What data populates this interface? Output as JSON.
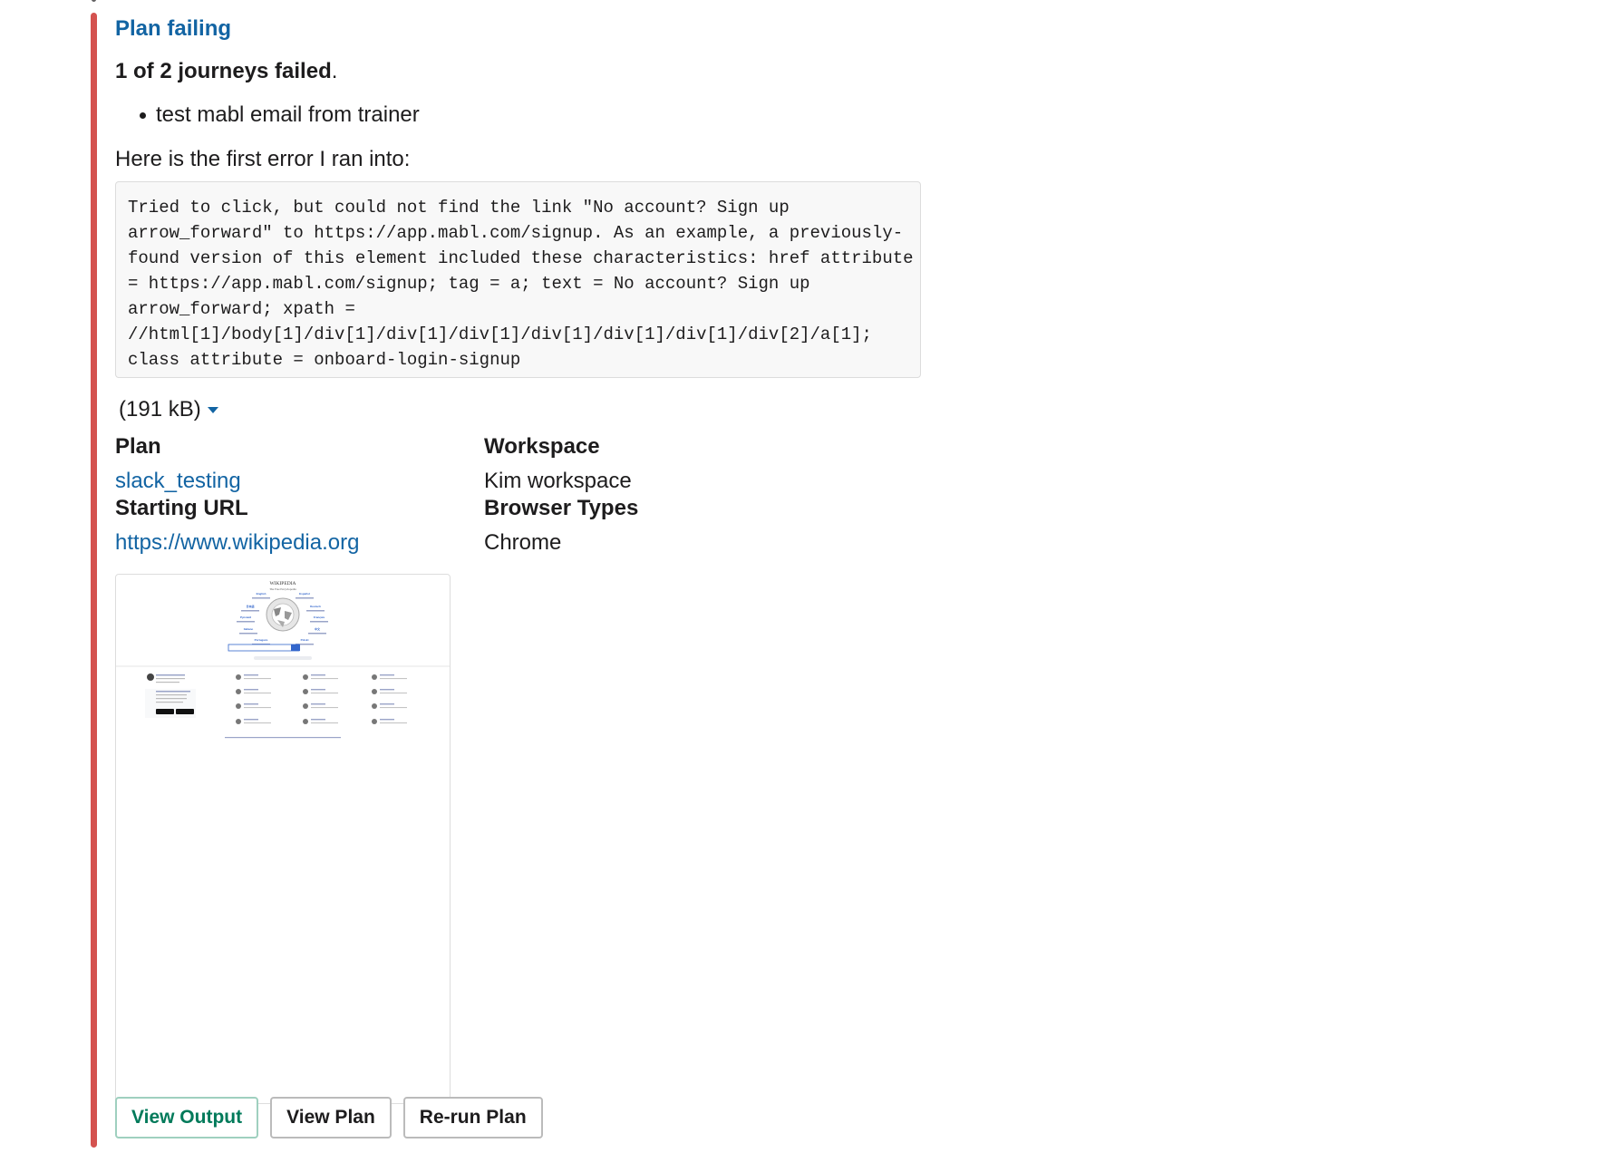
{
  "message": {
    "title": "Plan failing",
    "summary_bold": "1 of 2 journeys failed",
    "summary_end": ".",
    "failed_journeys": [
      "test mabl email from trainer"
    ],
    "intro": "Here is the first error I ran into:",
    "error_lines": [
      "Tried to click, but could not find the link \"No account? Sign up",
      "arrow_forward\" to https://app.mabl.com/signup. As an example, a previously-",
      "found version of this element included these characteristics: href attribute",
      "= https://app.mabl.com/signup; tag = a; text = No account? Sign up",
      "arrow_forward; xpath =",
      "//html[1]/body[1]/div[1]/div[1]/div[1]/div[1]/div[1]/div[1]/div[2]/a[1];",
      "class attribute = onboard-login-signup"
    ],
    "attachment_size": "(191 kB)",
    "accent_color": "#d4524f"
  },
  "fields": {
    "plan": {
      "label": "Plan",
      "value": "slack_testing"
    },
    "workspace": {
      "label": "Workspace",
      "value": "Kim workspace"
    },
    "starting_url": {
      "label": "Starting URL",
      "value": "https://www.wikipedia.org"
    },
    "browser_types": {
      "label": "Browser Types",
      "value": "Chrome"
    }
  },
  "screenshot": {
    "wordmark": "WIKIPEDIA",
    "tagline": "The Free Encyclopedia",
    "languages": [
      "English",
      "Español",
      "日本語",
      "Deutsch",
      "Русский",
      "Français",
      "Italiano",
      "中文",
      "Português",
      "Polski"
    ]
  },
  "buttons": {
    "view_output": "View Output",
    "view_plan": "View Plan",
    "rerun_plan": "Re-run Plan"
  },
  "colors": {
    "link": "#1264a3",
    "primary_button": "#007a5a"
  }
}
